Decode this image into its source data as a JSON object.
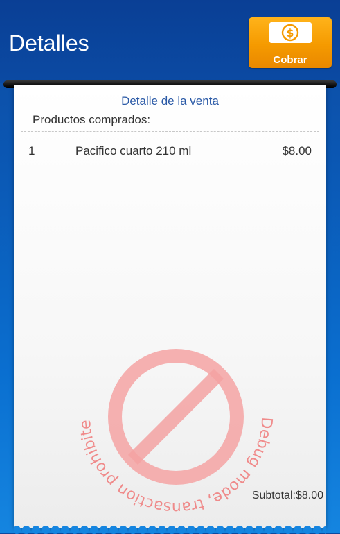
{
  "header": {
    "title": "Detalles",
    "button_label": "Cobrar"
  },
  "receipt": {
    "title": "Detalle de la venta",
    "products_label": "Productos comprados:",
    "items": [
      {
        "qty": "1",
        "name": "Pacifico cuarto 210 ml",
        "price": "$8.00"
      }
    ],
    "subtotal": "Subtotal:$8.00"
  },
  "watermark": {
    "text": "Debug mode, transaction prohibited! Debug mode, transaction prohibited!"
  },
  "colors": {
    "header": "#0b4aa3",
    "button": "#f59a00",
    "receipt_title": "#2a59a6",
    "watermark": "#f08080"
  },
  "icons": {
    "cobrar": "dollar-note-icon",
    "watermark": "prohibited-icon"
  }
}
